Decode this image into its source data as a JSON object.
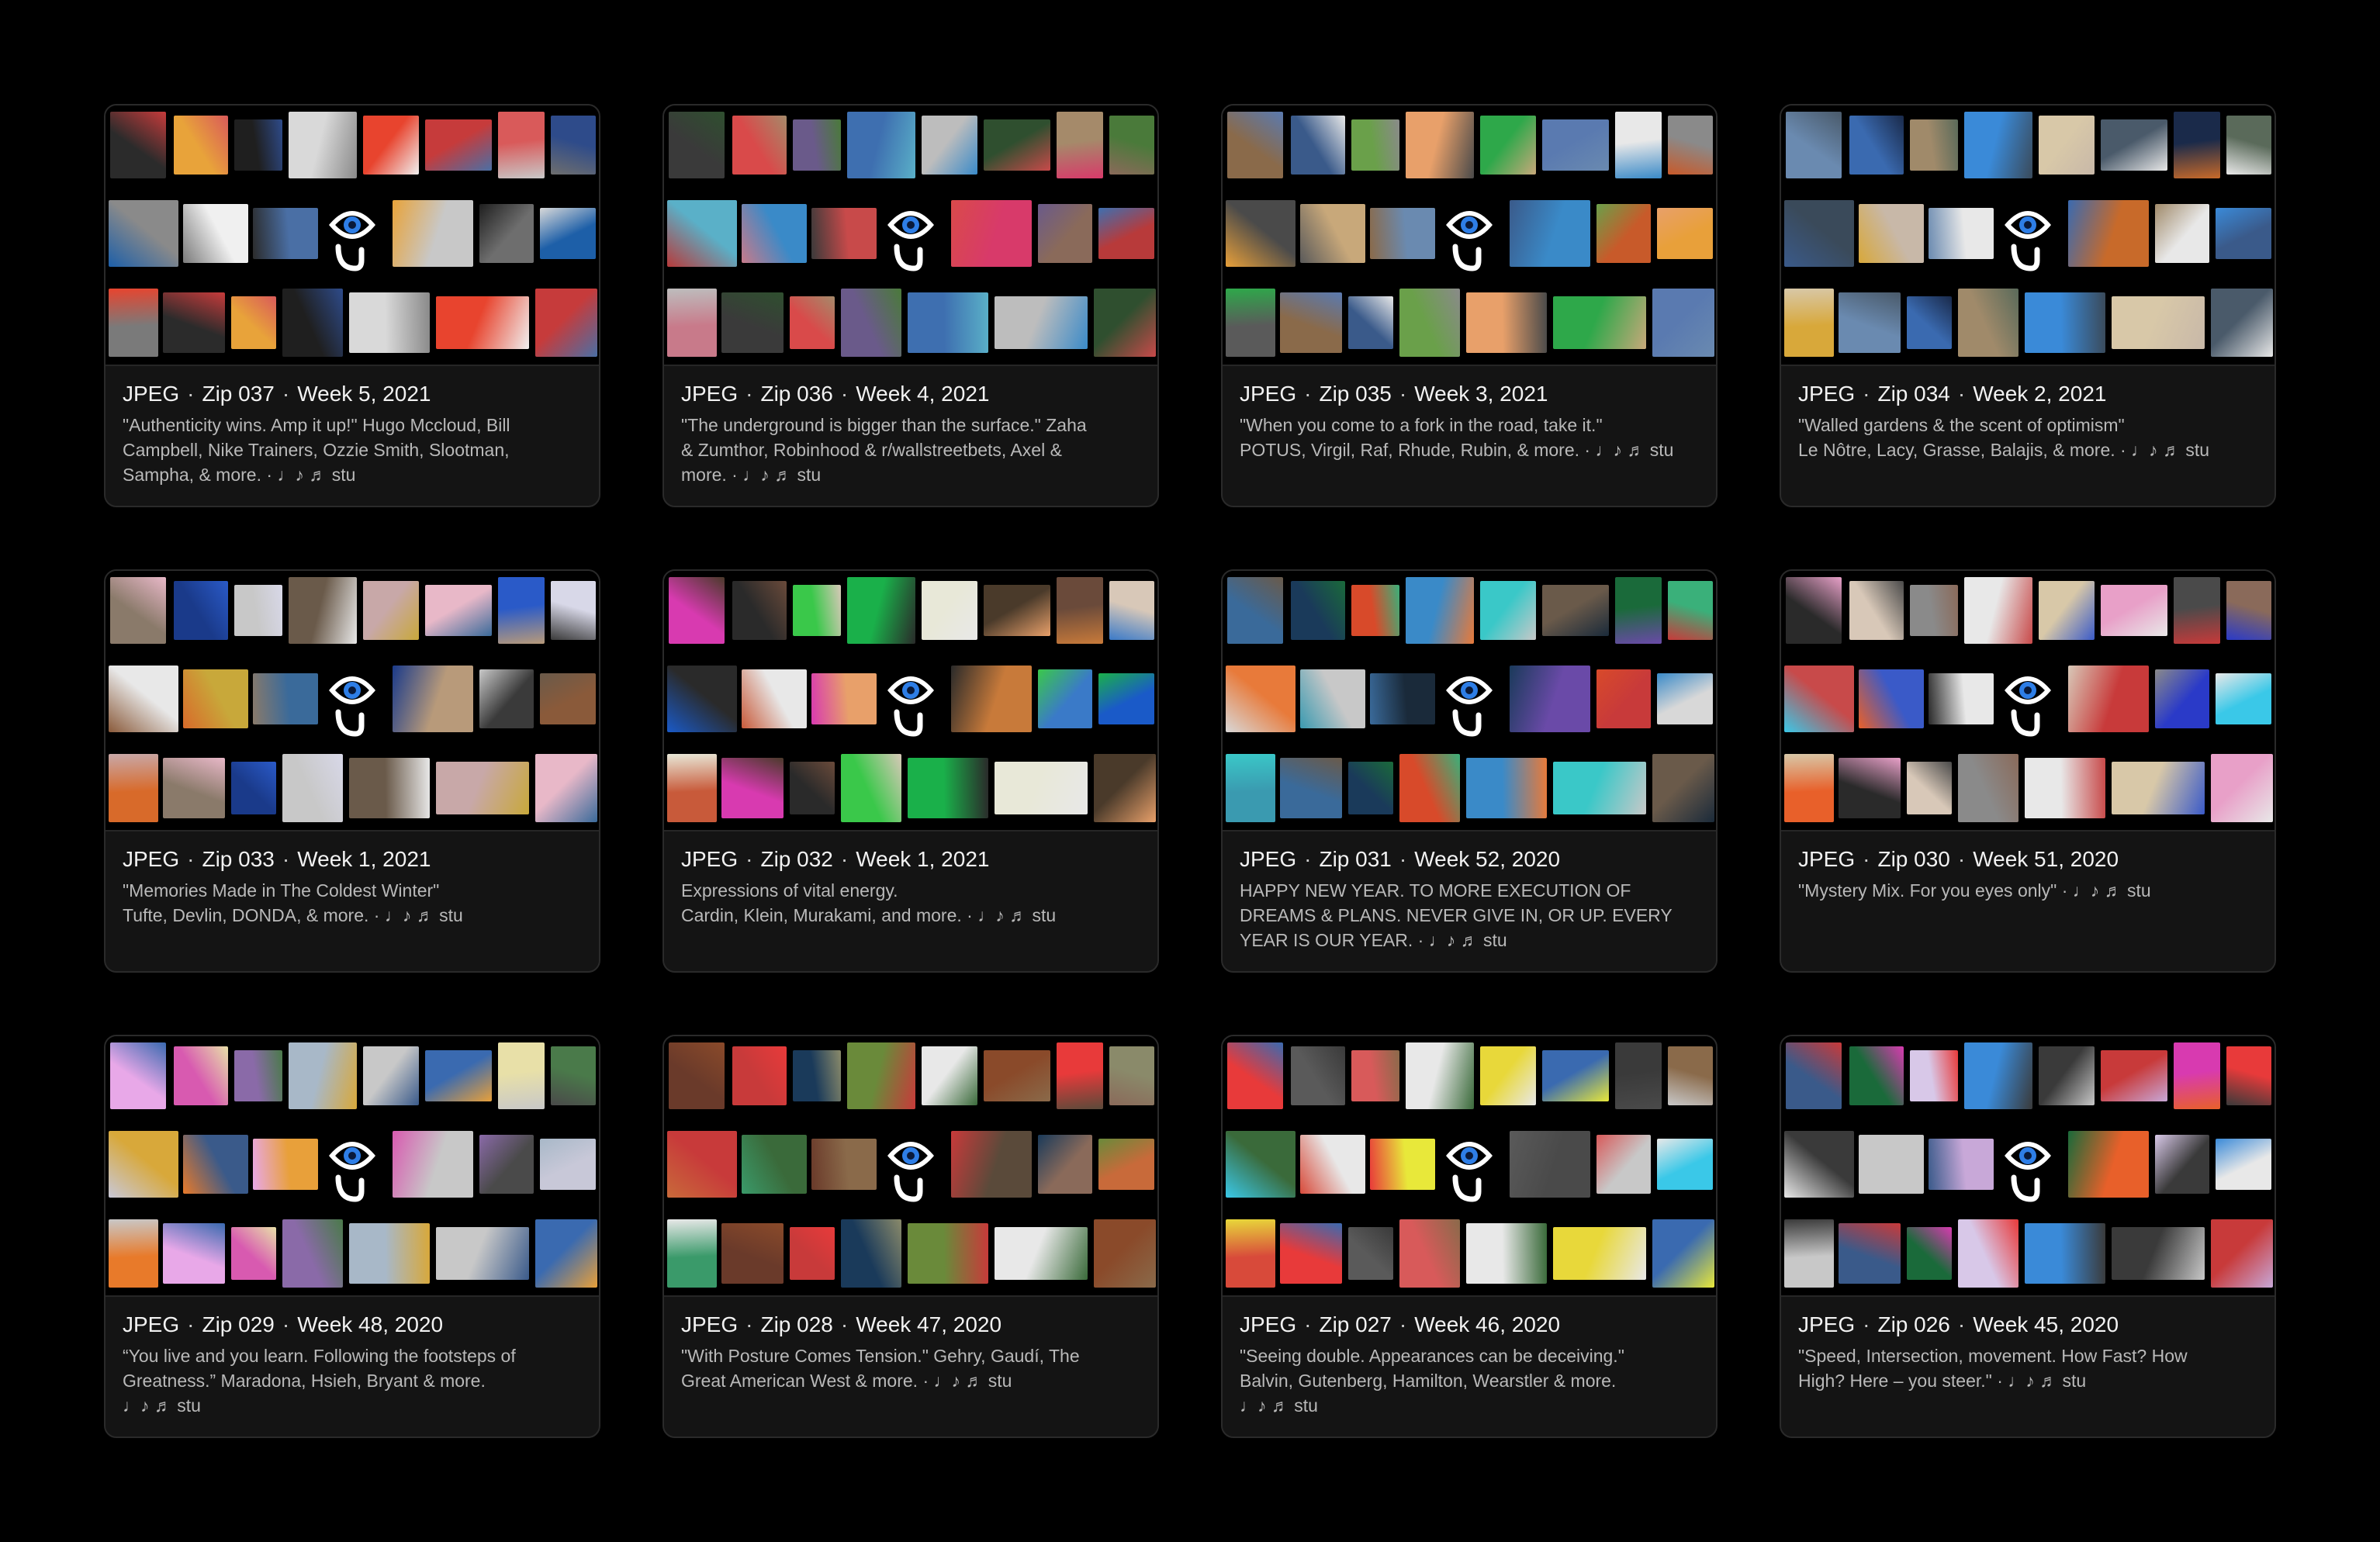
{
  "cards": [
    {
      "format": "JPEG",
      "zip": "Zip 037",
      "week": "Week 5, 2021",
      "line1": "\"Authenticity wins. Amp it up!\" Hugo Mccloud, Bill",
      "line2": "Campbell, Nike Trainers, Ozzie Smith, Slootman,",
      "line3": "Sampha, & more. · ♩♪ ♬ stu"
    },
    {
      "format": "JPEG",
      "zip": "Zip 036",
      "week": "Week 4, 2021",
      "line1": "\"The underground is bigger than the surface.\" Zaha",
      "line2": "& Zumthor, Robinhood & r/wallstreetbets, Axel &",
      "line3": "more. · ♩♪ ♬ stu"
    },
    {
      "format": "JPEG",
      "zip": "Zip 035",
      "week": "Week 3, 2021",
      "line1": "\"When you come to a fork in the road, take it.\"",
      "line2": "POTUS, Virgil, Raf, Rhude, Rubin, & more. · ♩♪ ♬ stu",
      "line3": ""
    },
    {
      "format": "JPEG",
      "zip": "Zip 034",
      "week": "Week 2, 2021",
      "line1": "\"Walled gardens & the scent of optimism\"",
      "line2": "Le Nôtre, Lacy, Grasse, Balajis, & more. · ♩♪ ♬ stu",
      "line3": ""
    },
    {
      "format": "JPEG",
      "zip": "Zip 033",
      "week": "Week 1, 2021",
      "line1": "\"Memories Made in The Coldest Winter\"",
      "line2": "Tufte, Devlin, DONDA, & more. · ♩♪ ♬ stu",
      "line3": ""
    },
    {
      "format": "JPEG",
      "zip": "Zip 032",
      "week": "Week 1, 2021",
      "line1": "Expressions of vital energy.",
      "line2": "Cardin, Klein, Murakami, and more. · ♩♪ ♬ stu",
      "line3": ""
    },
    {
      "format": "JPEG",
      "zip": "Zip 031",
      "week": "Week 52, 2020",
      "line1": "HAPPY NEW YEAR. TO MORE EXECUTION OF",
      "line2": "DREAMS & PLANS. NEVER GIVE IN, OR UP. EVERY",
      "line3": "YEAR IS OUR YEAR. · ♩♪ ♬ stu"
    },
    {
      "format": "JPEG",
      "zip": "Zip 030",
      "week": "Week 51, 2020",
      "line1": "\"Mystery Mix. For you eyes only\" · ♩♪ ♬ stu",
      "line2": "",
      "line3": ""
    },
    {
      "format": "JPEG",
      "zip": "Zip 029",
      "week": "Week 48, 2020",
      "line1": "“You live and you learn. Following the footsteps of",
      "line2": "Greatness.” Maradona, Hsieh, Bryant & more.",
      "line3": "♩♪ ♬ stu"
    },
    {
      "format": "JPEG",
      "zip": "Zip 028",
      "week": "Week 47, 2020",
      "line1": "\"With Posture Comes Tension.\" Gehry, Gaudí, The",
      "line2": "Great American West & more. · ♩♪ ♬ stu",
      "line3": ""
    },
    {
      "format": "JPEG",
      "zip": "Zip 027",
      "week": "Week 46, 2020",
      "line1": "\"Seeing double. Appearances can be deceiving.\"",
      "line2": "Balvin, Gutenberg, Hamilton, Wearstler & more.",
      "line3": "♩♪ ♬ stu"
    },
    {
      "format": "JPEG",
      "zip": "Zip 026",
      "week": "Week 45, 2020",
      "line1": "\"Speed, Intersection, movement. How Fast? How",
      "line2": "High? Here – you steer.\" · ♩♪ ♬ stu",
      "line3": ""
    }
  ],
  "palettes": [
    [
      "#2b2b2b",
      "#e8a33a",
      "#1f1f1f",
      "#d9d9d9",
      "#e8442e",
      "#c63b3b",
      "#d95a5a",
      "#2e4b8a",
      "#8a8a8a",
      "#f0f0f0",
      "#4a6fa5",
      "#c8c8c8",
      "#6e6e6e",
      "#1d5fa8",
      "#7a7a7a"
    ],
    [
      "#3a3a3a",
      "#d94a4a",
      "#6a5a8a",
      "#3e6fb0",
      "#bdbdbd",
      "#2f4f2f",
      "#a58a6a",
      "#4a7a3a",
      "#5ab0c8",
      "#3a8ac8",
      "#c84a4a",
      "#d83a6a",
      "#8a6a5a",
      "#b83a3a",
      "#c87a8a"
    ],
    [
      "#8a6a4a",
      "#3a5a8a",
      "#6aa04a",
      "#e8a06a",
      "#2ea84a",
      "#5a7ab0",
      "#e8e8e8",
      "#8a8a8a",
      "#4a4a4a",
      "#c8a87a",
      "#6a8ab0",
      "#3a8ac8",
      "#c85a2a",
      "#e8a03a",
      "#5a5a5a"
    ],
    [
      "#6a8ab0",
      "#3a6ab0",
      "#a08a6a",
      "#3a8ad8",
      "#d8c8a8",
      "#4a5a6a",
      "#1a2a4a",
      "#5a6a5a",
      "#3a4a5a",
      "#c8b8a8",
      "#e8e8e8",
      "#c86a2a",
      "#e8e8e8",
      "#3a5a8a",
      "#d8a83a"
    ],
    [
      "#8a7a6a",
      "#1a3a8a",
      "#c8c8c8",
      "#6a5a4a",
      "#c8a8a8",
      "#e8b8c8",
      "#2a5ac8",
      "#d8d8e8",
      "#e8e8e8",
      "#c8a83a",
      "#3a6a9a",
      "#b89a7a",
      "#3a3a3a",
      "#8a5a3a",
      "#d86a2a"
    ],
    [
      "#d83ab0",
      "#2a2a2a",
      "#3ac84a",
      "#1ab04a",
      "#e8e8d8",
      "#4a3a2a",
      "#6a4a3a",
      "#d8c8b8",
      "#2a2a2a",
      "#e8e8e8",
      "#e8a06a",
      "#c87a3a",
      "#3a7ac8",
      "#1a5ac8",
      "#c85a3a"
    ],
    [
      "#3a6a9a",
      "#1a3a5a",
      "#d84a2a",
      "#3a8ac8",
      "#3ac8c8",
      "#6a5a4a",
      "#1a6a3a",
      "#3ab07a",
      "#e87a3a",
      "#c8c8c8",
      "#1a2a3a",
      "#6a4aa8",
      "#c83a3a",
      "#d8d8d8",
      "#3a9ab0"
    ],
    [
      "#2a2a2a",
      "#d8c8b8",
      "#8a8a8a",
      "#e8e8e8",
      "#d8c8a8",
      "#e8a0c8",
      "#4a4a4a",
      "#8a6a5a",
      "#c84a4a",
      "#3a5ac8",
      "#e8e8e8",
      "#c83a3a",
      "#2a3ac8",
      "#3ac8e8",
      "#e8602a"
    ],
    [
      "#e8a8e8",
      "#d85ab0",
      "#8a6aa8",
      "#a8b8c8",
      "#c8c8c8",
      "#3a6ab0",
      "#e8e0a8",
      "#4a7a4a",
      "#d8a83a",
      "#3a5a8a",
      "#e8a03a",
      "#c8c8c8",
      "#4a4a4a",
      "#c8c8d8",
      "#e87a2a"
    ],
    [
      "#6a3a2a",
      "#c83a3a",
      "#1a3a5a",
      "#6a8a3a",
      "#e8e8e8",
      "#8a4a2a",
      "#e83a3a",
      "#8a8a6a",
      "#c83a3a",
      "#3a6a3a",
      "#8a6a4a",
      "#5a4a3a",
      "#8a6a5a",
      "#c86a3a",
      "#3a9a6a"
    ],
    [
      "#e83a3a",
      "#5a5a5a",
      "#d85a5a",
      "#e8e8e8",
      "#e8d83a",
      "#3a6ab0",
      "#3a3a3a",
      "#8a6a4a",
      "#3a6a3a",
      "#e8e8e8",
      "#e8e83a",
      "#4a4a4a",
      "#c8c8c8",
      "#3ac8e8",
      "#d84a3a"
    ],
    [
      "#3a5a8a",
      "#1a6a3a",
      "#d8c8e8",
      "#3a8ad8",
      "#3a3a3a",
      "#c83a3a",
      "#d83ab0",
      "#e83a3a",
      "#3a3a3a",
      "#c8c8c8",
      "#c8a8d8",
      "#e8602a",
      "#3a3a3a",
      "#e8e8e8",
      "#c8c8c8"
    ]
  ]
}
